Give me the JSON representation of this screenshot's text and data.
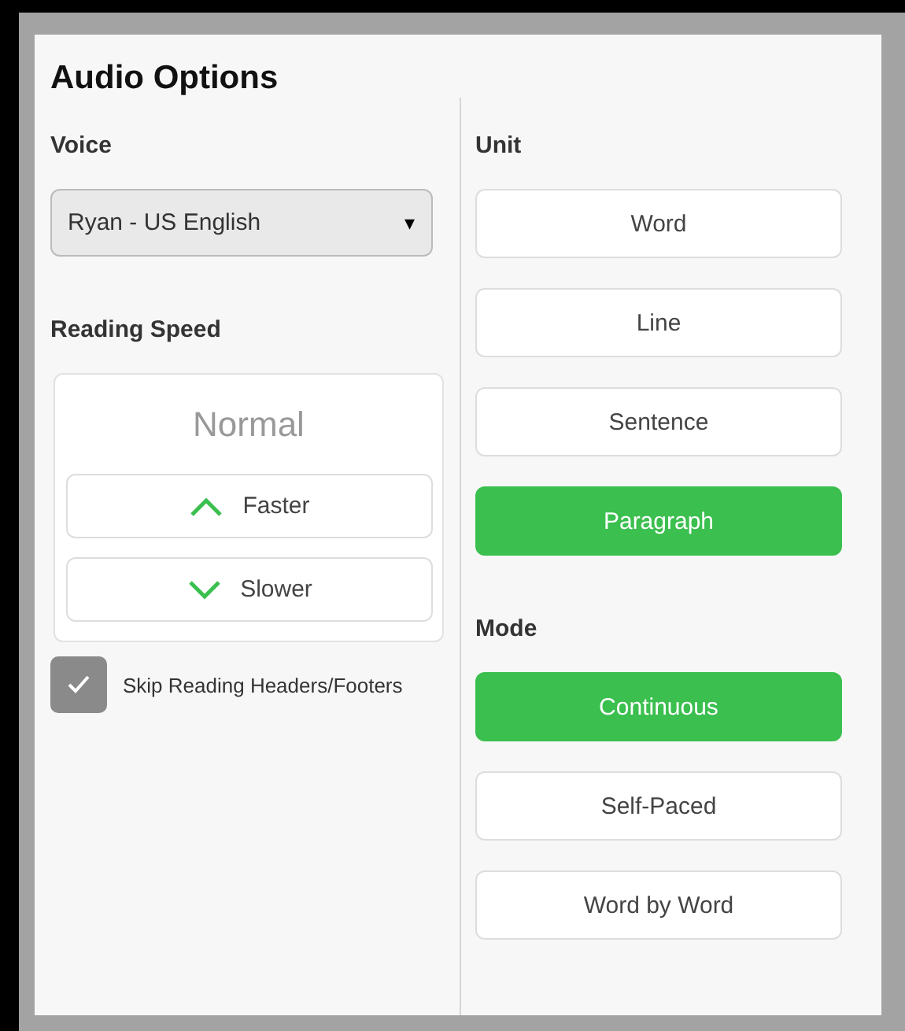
{
  "title": "Audio Options",
  "voice": {
    "label": "Voice",
    "value": "Ryan - US English",
    "arrow": "▾"
  },
  "reading_speed": {
    "label": "Reading Speed",
    "value": "Normal",
    "buttons": [
      {
        "label": "Faster",
        "kind": "up"
      },
      {
        "label": "Slower",
        "kind": "down"
      }
    ]
  },
  "skip_headers": {
    "label": "Skip Reading Headers/Footers",
    "checked": true
  },
  "unit": {
    "label": "Unit",
    "options": [
      {
        "label": "Word",
        "selected": false
      },
      {
        "label": "Line",
        "selected": false
      },
      {
        "label": "Sentence",
        "selected": false
      },
      {
        "label": "Paragraph",
        "selected": true
      }
    ]
  },
  "mode": {
    "label": "Mode",
    "options": [
      {
        "label": "Continuous",
        "selected": true
      },
      {
        "label": "Self-Paced",
        "selected": false
      },
      {
        "label": "Word by Word",
        "selected": false
      }
    ]
  }
}
